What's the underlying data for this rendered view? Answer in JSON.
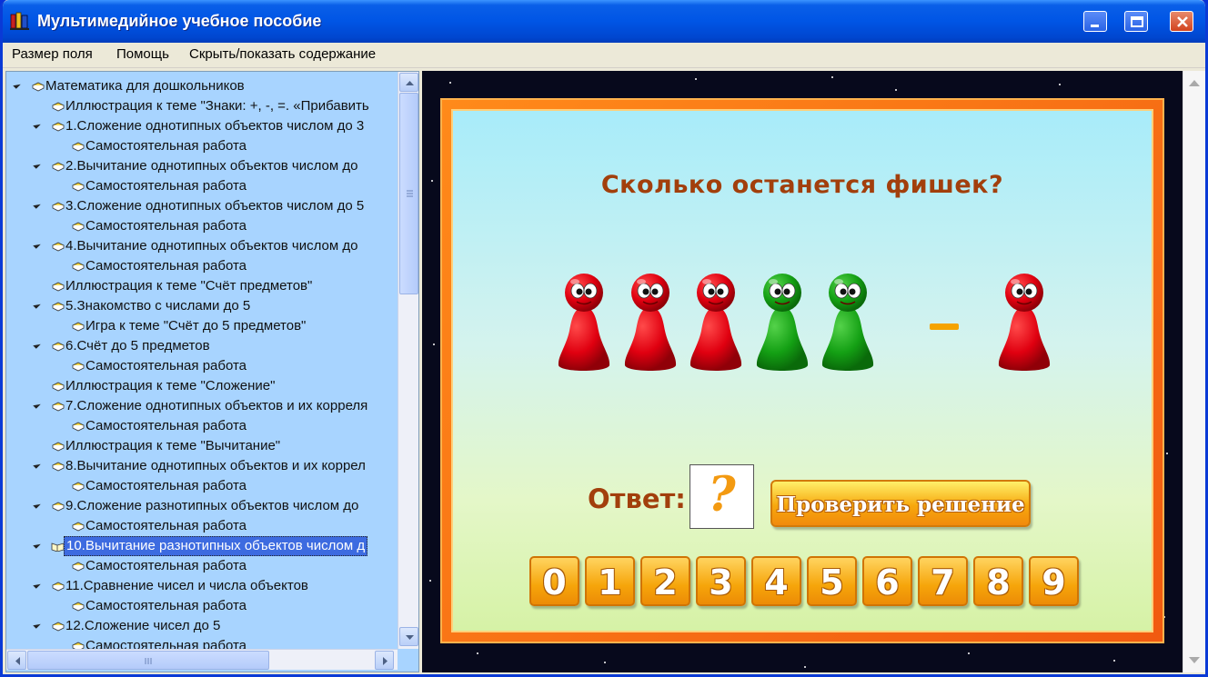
{
  "window": {
    "title": "Мультимедийное учебное пособие"
  },
  "menu": [
    {
      "label": "Размер поля"
    },
    {
      "label": "Помощь"
    },
    {
      "label": "Скрыть/показать содержание"
    }
  ],
  "tree": [
    {
      "label": "Математика для дошкольников",
      "level": 0,
      "expandable": true
    },
    {
      "label": "Иллюстрация к теме \"Знаки: +, -, =. «Прибавить",
      "level": 1,
      "expandable": false
    },
    {
      "label": "1.Сложение однотипных объектов числом до 3",
      "level": 1,
      "expandable": true
    },
    {
      "label": "Самостоятельная работа",
      "level": 2,
      "expandable": false
    },
    {
      "label": "2.Вычитание однотипных объектов числом до",
      "level": 1,
      "expandable": true
    },
    {
      "label": "Самостоятельная работа",
      "level": 2,
      "expandable": false
    },
    {
      "label": "3.Сложение однотипных объектов числом до 5",
      "level": 1,
      "expandable": true
    },
    {
      "label": "Самостоятельная работа",
      "level": 2,
      "expandable": false
    },
    {
      "label": "4.Вычитание однотипных объектов числом до",
      "level": 1,
      "expandable": true
    },
    {
      "label": "Самостоятельная работа",
      "level": 2,
      "expandable": false
    },
    {
      "label": "Иллюстрация к теме \"Счёт предметов\"",
      "level": 1,
      "expandable": false
    },
    {
      "label": "5.Знакомство с числами до 5",
      "level": 1,
      "expandable": true
    },
    {
      "label": "Игра к теме \"Счёт до 5 предметов\"",
      "level": 2,
      "expandable": false
    },
    {
      "label": "6.Счёт до 5 предметов",
      "level": 1,
      "expandable": true
    },
    {
      "label": "Самостоятельная работа",
      "level": 2,
      "expandable": false
    },
    {
      "label": "Иллюстрация к теме \"Сложение\"",
      "level": 1,
      "expandable": false
    },
    {
      "label": "7.Сложение однотипных объектов и их корреля",
      "level": 1,
      "expandable": true
    },
    {
      "label": "Самостоятельная работа",
      "level": 2,
      "expandable": false
    },
    {
      "label": "Иллюстрация к теме \"Вычитание\"",
      "level": 1,
      "expandable": false
    },
    {
      "label": "8.Вычитание однотипных объектов и их коррел",
      "level": 1,
      "expandable": true
    },
    {
      "label": "Самостоятельная работа",
      "level": 2,
      "expandable": false
    },
    {
      "label": "9.Сложение разнотипных объектов числом до",
      "level": 1,
      "expandable": true
    },
    {
      "label": "Самостоятельная работа",
      "level": 2,
      "expandable": false
    },
    {
      "label": "10.Вычитание разнотипных объектов числом д",
      "level": 1,
      "expandable": true,
      "selected": true
    },
    {
      "label": "Самостоятельная работа",
      "level": 2,
      "expandable": false
    },
    {
      "label": "11.Сравнение чисел и числа объектов",
      "level": 1,
      "expandable": true
    },
    {
      "label": "Самостоятельная работа",
      "level": 2,
      "expandable": false
    },
    {
      "label": "12.Сложение чисел до 5",
      "level": 1,
      "expandable": true
    },
    {
      "label": "Самостоятельная работа",
      "level": 2,
      "expandable": false
    }
  ],
  "exercise": {
    "question": "Сколько останется фишек?",
    "left_chips": [
      "red",
      "red",
      "red",
      "green",
      "green"
    ],
    "operator": "–",
    "right_chips": [
      "red"
    ],
    "answer_label": "Ответ:",
    "answer_value": "?",
    "check_button": "Проверить решение",
    "digits": [
      "0",
      "1",
      "2",
      "3",
      "4",
      "5",
      "6",
      "7",
      "8",
      "9"
    ]
  },
  "colors": {
    "accent_orange": "#f6a50a",
    "question_text": "#a23f0c",
    "tree_background": "#a8d4ff",
    "titlebar": "#0055e5"
  }
}
